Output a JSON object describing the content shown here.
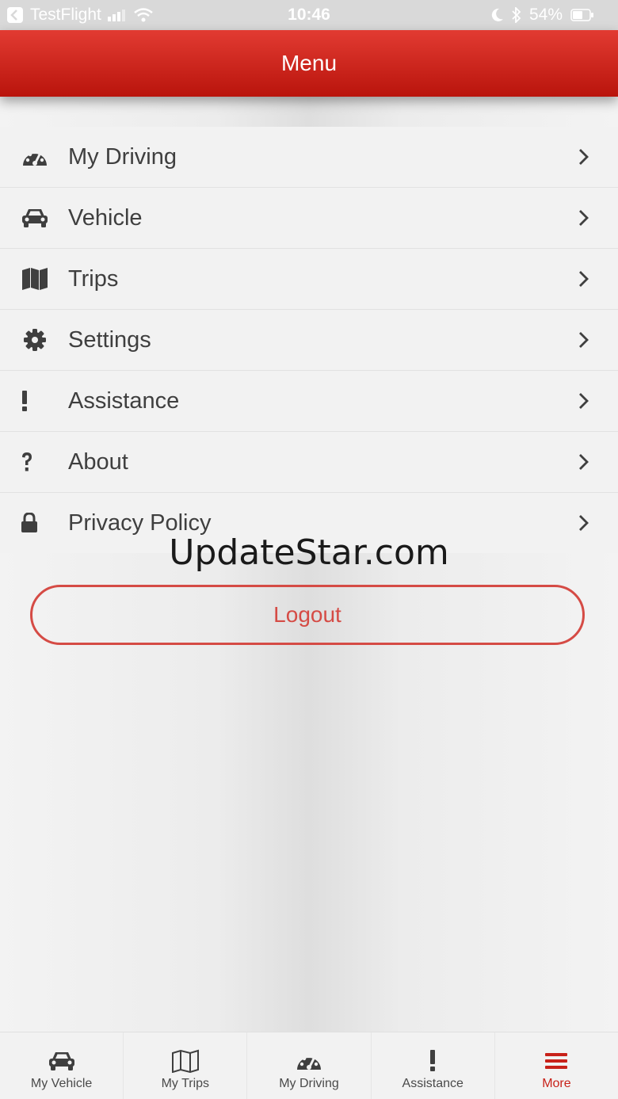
{
  "status_bar": {
    "carrier": "TestFlight",
    "time": "10:46",
    "battery": "54%"
  },
  "header": {
    "title": "Menu"
  },
  "menu": {
    "items": [
      {
        "label": "My Driving",
        "icon": "speedometer-icon"
      },
      {
        "label": "Vehicle",
        "icon": "car-icon"
      },
      {
        "label": "Trips",
        "icon": "map-icon"
      },
      {
        "label": "Settings",
        "icon": "gear-icon"
      },
      {
        "label": "Assistance",
        "icon": "exclamation-icon"
      },
      {
        "label": "About",
        "icon": "question-icon"
      },
      {
        "label": "Privacy Policy",
        "icon": "lock-icon"
      }
    ]
  },
  "watermark": "UpdateStar.com",
  "logout": {
    "label": "Logout"
  },
  "tabs": [
    {
      "label": "My Vehicle",
      "icon": "car-icon"
    },
    {
      "label": "My Trips",
      "icon": "map-icon"
    },
    {
      "label": "My Driving",
      "icon": "speedometer-icon"
    },
    {
      "label": "Assistance",
      "icon": "exclamation-icon"
    },
    {
      "label": "More",
      "icon": "hamburger-icon",
      "active": true
    }
  ],
  "colors": {
    "accent": "#c8221a",
    "header_top": "#e23b32",
    "header_bottom": "#b9140c",
    "logout_border": "#d54b45"
  }
}
